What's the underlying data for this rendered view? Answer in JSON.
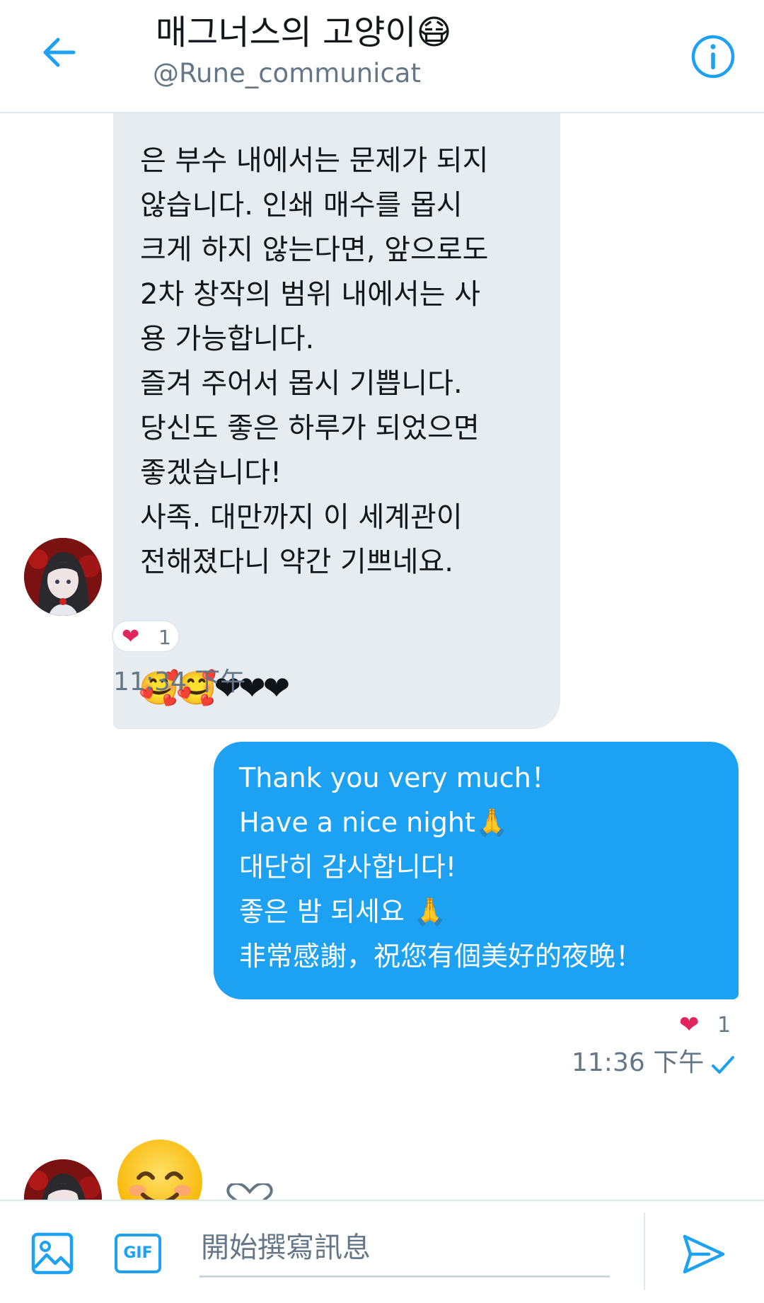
{
  "header": {
    "title": "매그너스의 고양이😷",
    "handle": "@Rune_communicat",
    "back_icon": "arrow-left-icon",
    "info_icon": "info-icon"
  },
  "messages": {
    "received": {
      "text": "은 부수 내에서는 문제가 되지\n않습니다. 인쇄 매수를 몹시\n크게 하지 않는다면, 앞으로도\n2차 창작의 범위 내에서는 사\n용 가능합니다.\n즐겨 주어서 몹시 기쁩니다.\n당신도 좋은 하루가 되었으면\n좋겠습니다!\n사족. 대만까지 이 세계관이\n전해졌다니 약간 기쁘네요.",
      "emojis": "🥰🥰❤❤❤",
      "reaction_count": "1",
      "time": "11:34 下午"
    },
    "sent": {
      "text": "Thank you very much！\nHave a nice night🙏\n대단히 감사합니다!\n 좋은 밤 되세요 🙏\n非常感謝，祝您有個美好的夜晚！",
      "reaction_count": "1",
      "time": "11:36 下午"
    },
    "received_emoji": "smiling-face-emoji"
  },
  "composer": {
    "placeholder": "開始撰寫訊息",
    "gif_label": "GIF"
  },
  "colors": {
    "accent": "#1da1f2",
    "received_bubble": "#e6ecf0",
    "heart": "#e0245e",
    "muted_text": "#657786"
  }
}
